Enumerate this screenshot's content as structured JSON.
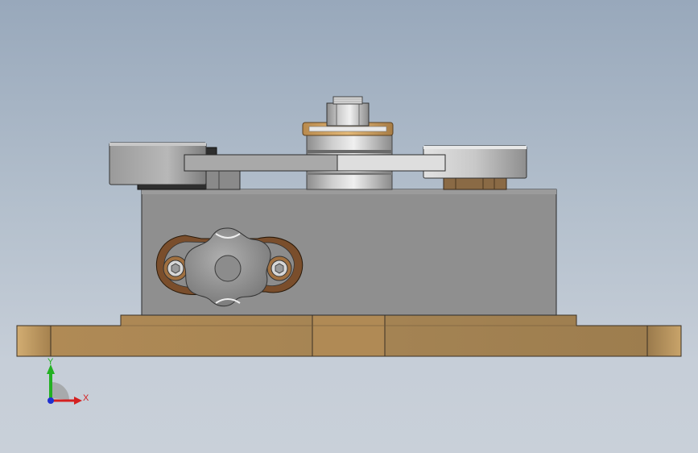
{
  "viewport": {
    "background_top": "#98a8bb",
    "background_bottom": "#c9d0d9"
  },
  "model": {
    "base_color": "#a8875a",
    "block_color": "#8e8e8e",
    "knob_color": "#8a8a8a",
    "washer_color": "#c89a5a"
  },
  "triad": {
    "x_label": "X",
    "y_label": "Y",
    "x_color": "#d42020",
    "y_color": "#22b022",
    "z_color": "#2030d0"
  }
}
